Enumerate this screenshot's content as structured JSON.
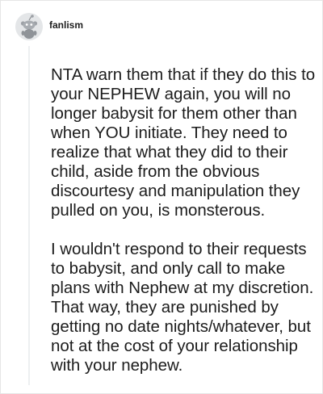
{
  "comment": {
    "username": "fanlism",
    "avatar_icon": "snoo-avatar-icon",
    "paragraphs": [
      "NTA warn them that if they do this to your NEPHEW again, you will no longer babysit for them other than when YOU initiate. They need to realize that what they did to their child, aside from the obvious discourtesy and manipulation they pulled on you, is monsterous.",
      "I wouldn't respond to their requests to babysit, and only call to make plans with Nephew at my discretion. That way, they are punished by getting no date nights/whatever, but not at the cost of your relationship with your nephew."
    ]
  }
}
